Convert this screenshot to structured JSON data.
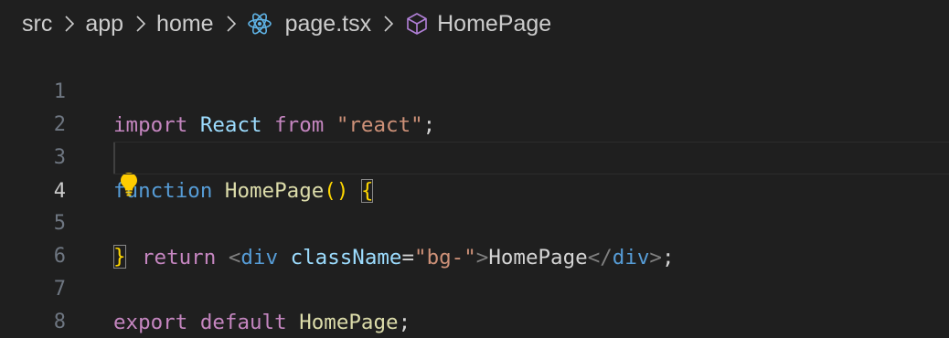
{
  "breadcrumb": {
    "items": [
      "src",
      "app",
      "home",
      "page.tsx",
      "HomePage"
    ],
    "separator_icon": "chevron-right-icon",
    "file_icon": "react-icon",
    "symbol_icon": "cube-icon"
  },
  "colors": {
    "background": "#1f1f1f",
    "keyword": "#c586c0",
    "identifier": "#9cdcfe",
    "string": "#ce9178",
    "function": "#dcdcaa",
    "bracket": "#ffd700",
    "tag": "#569cd6",
    "react_icon": "#5fb3e6",
    "cube_icon": "#b180d7",
    "lightbulb": "#ffcc00"
  },
  "editor": {
    "current_line": 4,
    "lines": [
      {
        "number": "1",
        "tokens": [
          "import",
          "React",
          "from",
          "\"react\"",
          ";"
        ]
      },
      {
        "number": "2",
        "tokens": []
      },
      {
        "number": "3",
        "tokens": [
          "function",
          "HomePage",
          "()",
          "{"
        ]
      },
      {
        "number": "4",
        "tokens": [
          "return",
          "<",
          "div",
          "className",
          "=",
          "\"bg-\"",
          ">",
          "HomePage",
          "</",
          "div",
          ">",
          ";"
        ]
      },
      {
        "number": "5",
        "tokens": [
          "}"
        ]
      },
      {
        "number": "6",
        "tokens": []
      },
      {
        "number": "7",
        "tokens": [
          "export",
          "default",
          "HomePage",
          ";"
        ]
      },
      {
        "number": "8",
        "tokens": []
      }
    ]
  },
  "lightbulb_icon": "lightbulb-icon"
}
